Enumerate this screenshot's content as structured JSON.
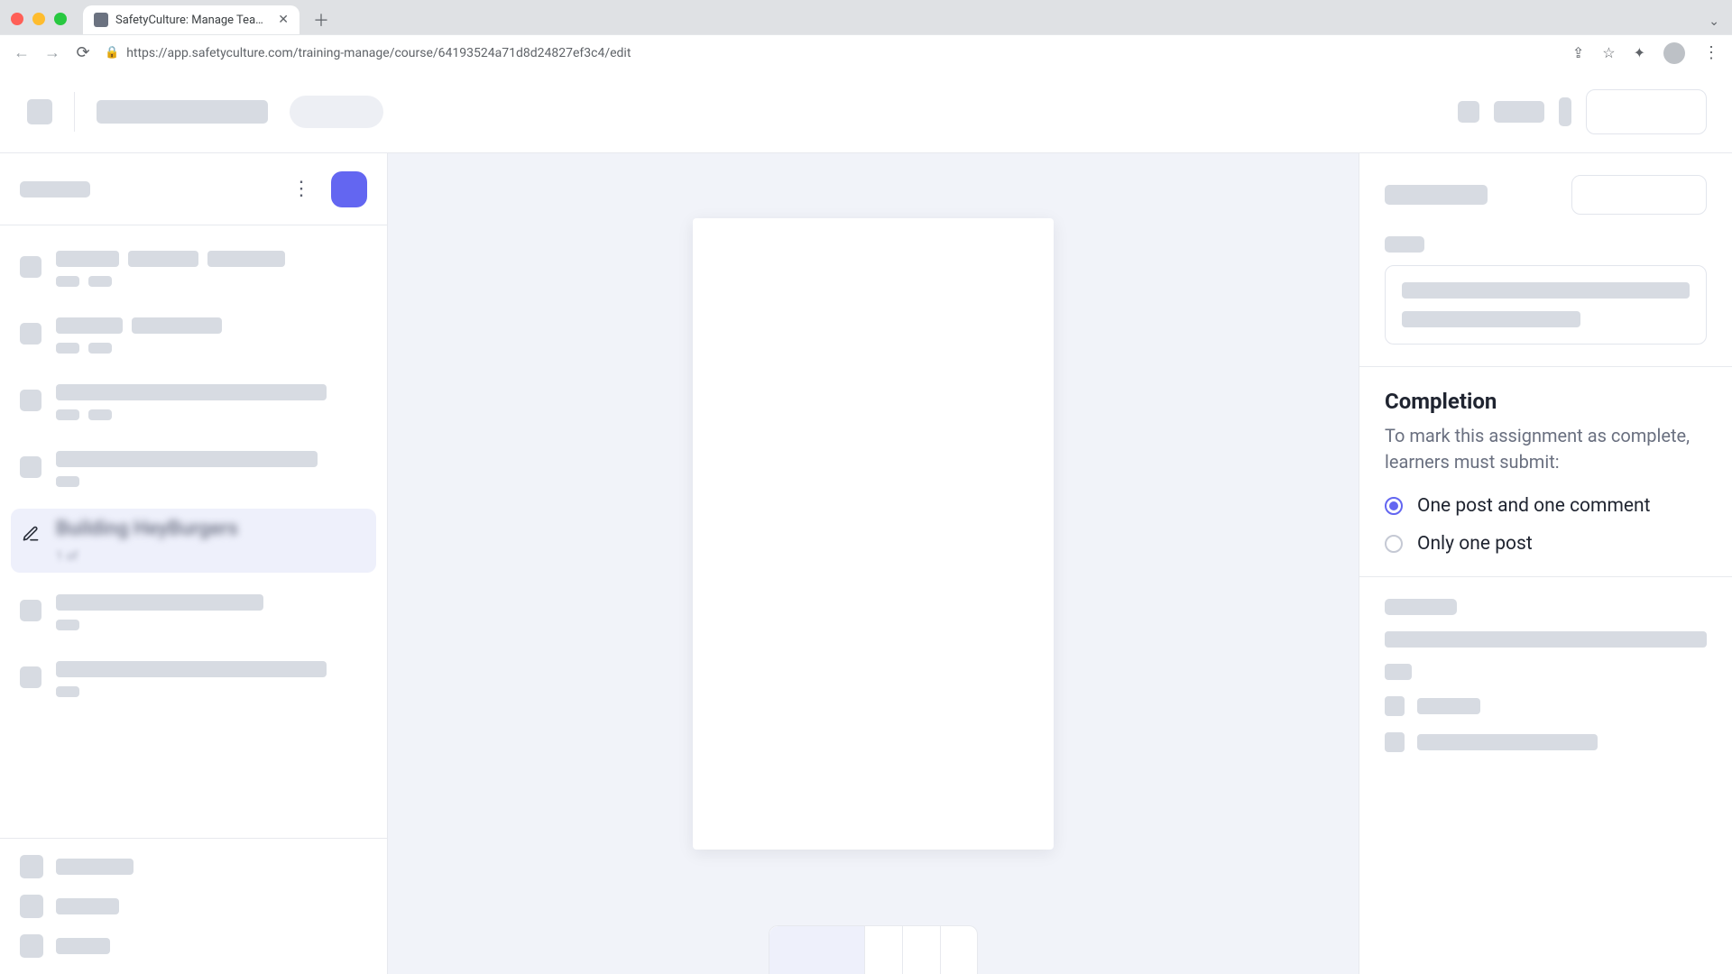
{
  "browser": {
    "tab_title": "SafetyCulture: Manage Teams and ...",
    "url": "https://app.safetyculture.com/training-manage/course/64193524a71d8d24827ef3c4/edit"
  },
  "left_panel": {
    "active_lesson": {
      "title": "Building HeyBurgers",
      "meta": "1 of"
    }
  },
  "right_panel": {
    "completion": {
      "title": "Completion",
      "description": "To mark this assignment as complete, learners must submit:",
      "options": [
        {
          "label": "One post and one comment",
          "value": "post_and_comment",
          "selected": true
        },
        {
          "label": "Only one post",
          "value": "only_post",
          "selected": false
        }
      ]
    }
  },
  "colors": {
    "accent": "#6366f1",
    "skeleton": "#d7dbe2"
  }
}
